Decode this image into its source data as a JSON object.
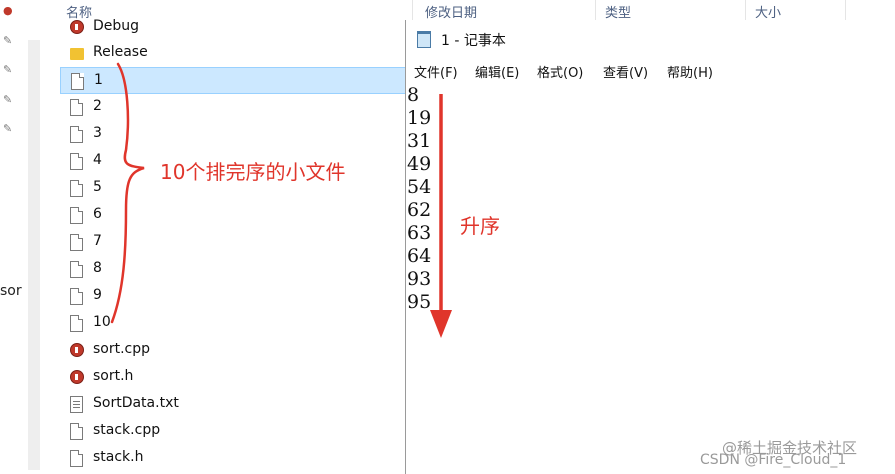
{
  "explorer": {
    "columns": {
      "name": "名称",
      "date_modified": "修改日期",
      "type": "类型",
      "size": "大小"
    },
    "side_text": "sor",
    "files": [
      {
        "name": "Debug",
        "icon": "vs-file-icon"
      },
      {
        "name": "Release",
        "icon": "folder-icon"
      },
      {
        "name": "1",
        "icon": "document-icon",
        "selected": true
      },
      {
        "name": "2",
        "icon": "document-icon"
      },
      {
        "name": "3",
        "icon": "document-icon"
      },
      {
        "name": "4",
        "icon": "document-icon"
      },
      {
        "name": "5",
        "icon": "document-icon"
      },
      {
        "name": "6",
        "icon": "document-icon"
      },
      {
        "name": "7",
        "icon": "document-icon"
      },
      {
        "name": "8",
        "icon": "document-icon"
      },
      {
        "name": "9",
        "icon": "document-icon"
      },
      {
        "name": "10",
        "icon": "document-icon"
      },
      {
        "name": "sort.cpp",
        "icon": "cpp-file-icon"
      },
      {
        "name": "sort.h",
        "icon": "cpp-file-icon"
      },
      {
        "name": "SortData.txt",
        "icon": "text-file-icon"
      },
      {
        "name": "stack.cpp",
        "icon": "document-icon"
      },
      {
        "name": "stack.h",
        "icon": "document-icon"
      }
    ]
  },
  "annotations": {
    "brace_note": "10个排完序的小文件",
    "ascending_note": "升序",
    "accent_color": "#e0352b"
  },
  "notepad": {
    "title": "1 - 记事本",
    "menu": [
      "文件(F)",
      "编辑(E)",
      "格式(O)",
      "查看(V)",
      "帮助(H)"
    ],
    "lines": [
      "8",
      "19",
      "31",
      "49",
      "54",
      "62",
      "63",
      "64",
      "93",
      "95"
    ]
  },
  "watermark": {
    "line1": "@稀土掘金技术社区",
    "line2": "CSDN @Fire_Cloud_1"
  }
}
